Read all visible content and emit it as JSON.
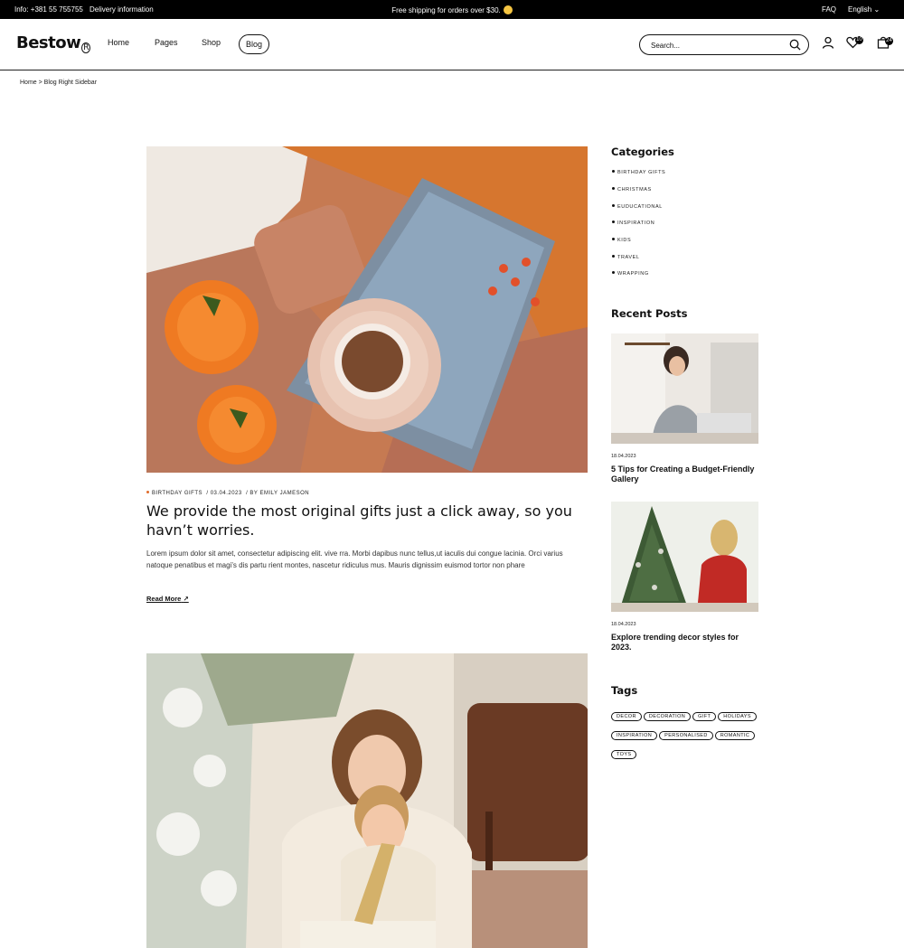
{
  "topbar": {
    "info": "Info: +381 55 755755",
    "delivery": "Delivery information",
    "promo": "Free shipping for orders over $30.",
    "faq": "FAQ",
    "language": "English ⌄"
  },
  "header": {
    "logo": "Bestow",
    "logo_mark": "R",
    "nav": [
      "Home",
      "Pages",
      "Shop",
      "Blog"
    ],
    "search_placeholder": "Search...",
    "wishlist_count": "10",
    "cart_count": "24"
  },
  "breadcrumb": "Home > Blog Right Sidebar",
  "post": {
    "category": "BIRTHDAY GIFTS",
    "date": "03.04.2023",
    "author": "BY EMILY JAMESON",
    "title": "We provide the most original gifts just a click away, so you havn’t worries.",
    "excerpt": "Lorem ipsum dolor sit amet, consectetur adipiscing elit. vive rra. Morbi dapibus nunc tellus,ut iaculis dui congue lacinia. Orci varius natoque penatibus et magi’s dis partu rient montes, nascetur ridiculus mus. Mauris dignissim euismod tortor non phare",
    "read_more": "Read More"
  },
  "sidebar": {
    "categories_heading": "Categories",
    "categories": [
      "BIRTHDAY GIFTS",
      "CHRISTMAS",
      "EUDUCATIONAL",
      "INSPIRATION",
      "KIDS",
      "TRAVEL",
      "WRAPPING"
    ],
    "recent_heading": "Recent Posts",
    "recent": [
      {
        "date": "18.04.2023",
        "title": "5 Tips for Creating a Budget-Friendly Gallery"
      },
      {
        "date": "18.04.2023",
        "title": "Explore trending decor styles for 2023."
      }
    ],
    "tags_heading": "Tags",
    "tags": [
      "DECOR",
      "DECORATION",
      "GIFT",
      "HOLIDAYS",
      "INSPIRATION",
      "PERSONALISED",
      "ROMANTIC",
      "TOYS"
    ]
  },
  "colors": {
    "accent": "#e06c2b",
    "dark": "#000000"
  }
}
